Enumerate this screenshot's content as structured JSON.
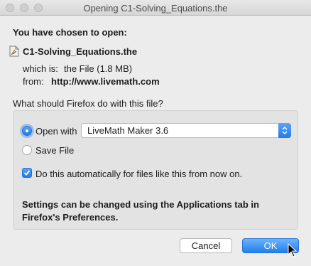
{
  "window": {
    "title": "Opening C1-Solving_Equations.the"
  },
  "header": {
    "heading": "You have chosen to open:"
  },
  "file": {
    "name": "C1-Solving_Equations.the",
    "which_is_label": "which is:",
    "which_is_value": "the File (1.8 MB)",
    "from_label": "from:",
    "from_value": "http://www.livemath.com"
  },
  "question": "What should Firefox do with this file?",
  "options": {
    "open_with_label": "Open with",
    "open_with_selected": true,
    "app_selected": "LiveMath Maker 3.6",
    "save_file_label": "Save File",
    "save_file_selected": false,
    "auto_label": "Do this automatically for files like this from now on.",
    "auto_checked": true
  },
  "note": "Settings can be changed using the Applications tab in Firefox's Preferences.",
  "buttons": {
    "cancel": "Cancel",
    "ok": "OK"
  },
  "colors": {
    "accent": "#2679e8",
    "background": "#ececec"
  },
  "icons": [
    "file-icon",
    "updown-chevron-icon",
    "checkmark-icon",
    "pointer-cursor-icon"
  ]
}
